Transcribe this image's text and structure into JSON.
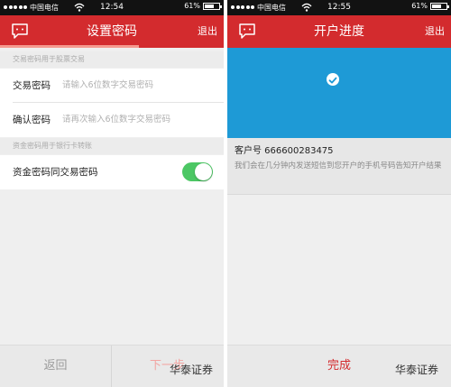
{
  "left": {
    "status": {
      "carrier": "中国电信",
      "time": "12:54",
      "battery": "61%"
    },
    "header": {
      "title": "设置密码",
      "exit": "退出"
    },
    "section1": "交易密码用于股票交易",
    "trade_password": {
      "label": "交易密码",
      "placeholder": "请输入6位数字交易密码"
    },
    "confirm_password": {
      "label": "确认密码",
      "placeholder": "请再次输入6位数字交易密码"
    },
    "section2": "资金密码用于银行卡转账",
    "fund_same": {
      "label": "资金密码同交易密码",
      "on": true
    },
    "buttons": {
      "back": "返回",
      "next": "下一步"
    },
    "watermark": "华泰证券"
  },
  "right": {
    "status": {
      "carrier": "中国电信",
      "time": "12:55",
      "battery": "61%"
    },
    "header": {
      "title": "开户进度",
      "exit": "退出"
    },
    "customer": "客户号 666600283475",
    "message": "我们会在几分钟内发送短信到您开户的手机号码告知开户结果",
    "buttons": {
      "done": "完成"
    },
    "watermark": "华泰证券"
  },
  "colors": {
    "header_red": "#d32b2e",
    "panel_blue": "#1e9ad6",
    "toggle_green": "#4cc764"
  },
  "icons": [
    "message-icon",
    "wifi-icon",
    "battery-icon",
    "check-icon"
  ]
}
